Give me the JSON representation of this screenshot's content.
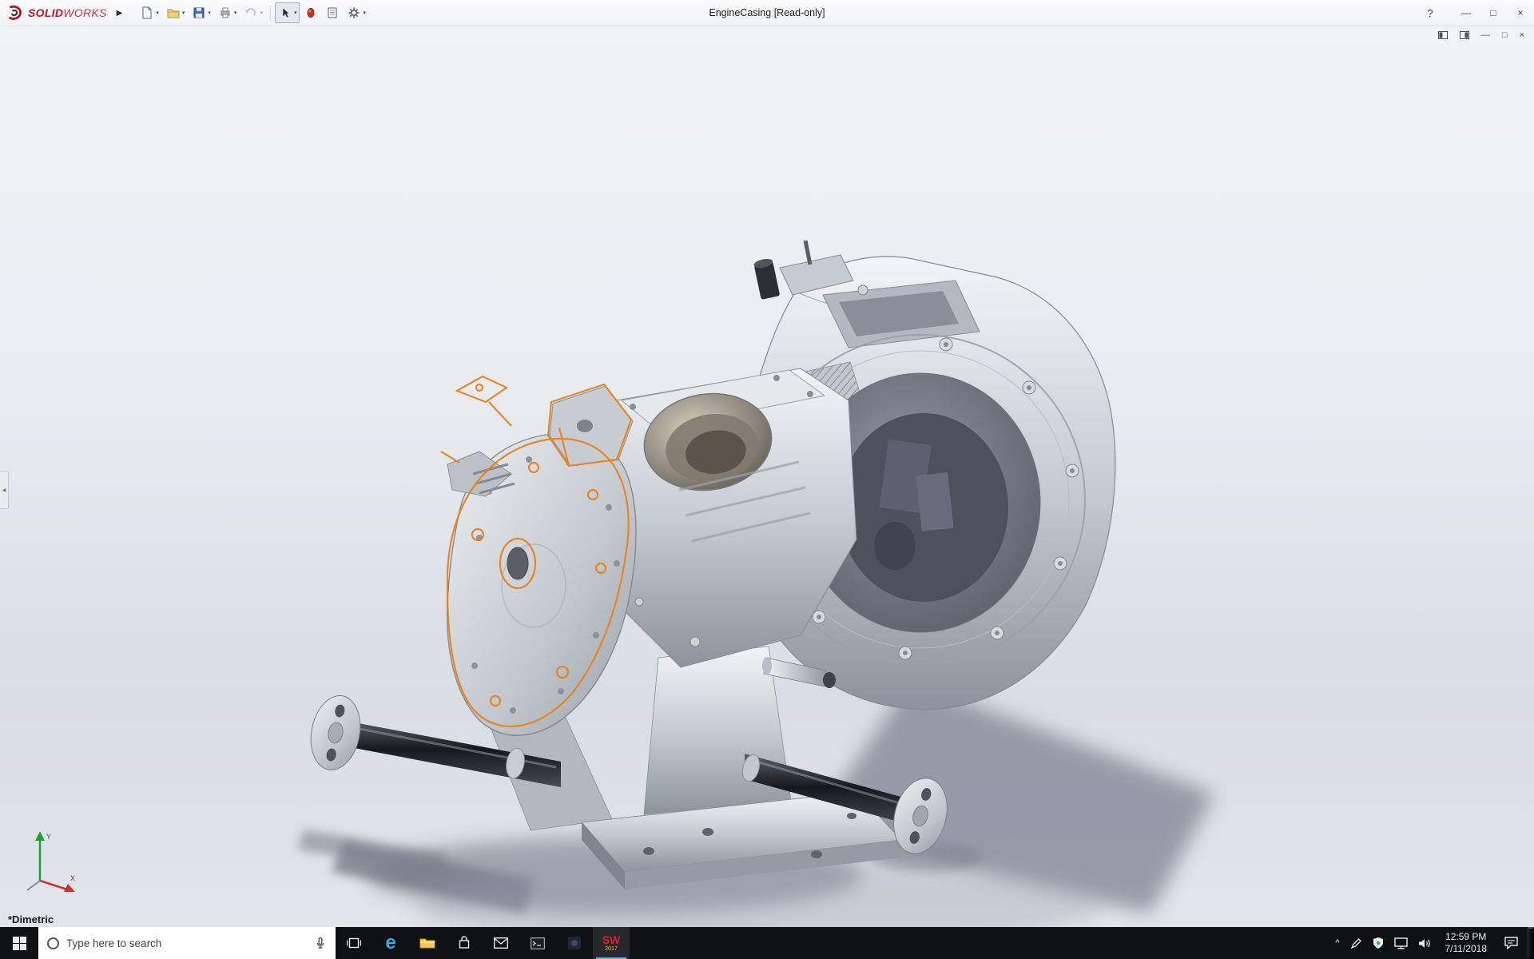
{
  "brand": {
    "solid": "SOLID",
    "works": "WORKS"
  },
  "icons": {
    "flyout": "▶",
    "caret": "▾",
    "help": "?",
    "minimize": "—",
    "maximize": "□",
    "close": "×",
    "collapse": "◀",
    "tray_chevron": "^",
    "edge": "e"
  },
  "titlebar": {
    "document_title": "EngineCasing [Read-only]"
  },
  "viewport": {
    "view_label": "*Dimetric",
    "triad": {
      "x": "X",
      "y": "Y"
    }
  },
  "taskbar": {
    "search_placeholder": "Type here to search",
    "solidworks_badge": {
      "top": "SW",
      "bottom": "2017"
    },
    "clock": {
      "time": "12:59 PM",
      "date": "7/11/2018"
    }
  }
}
